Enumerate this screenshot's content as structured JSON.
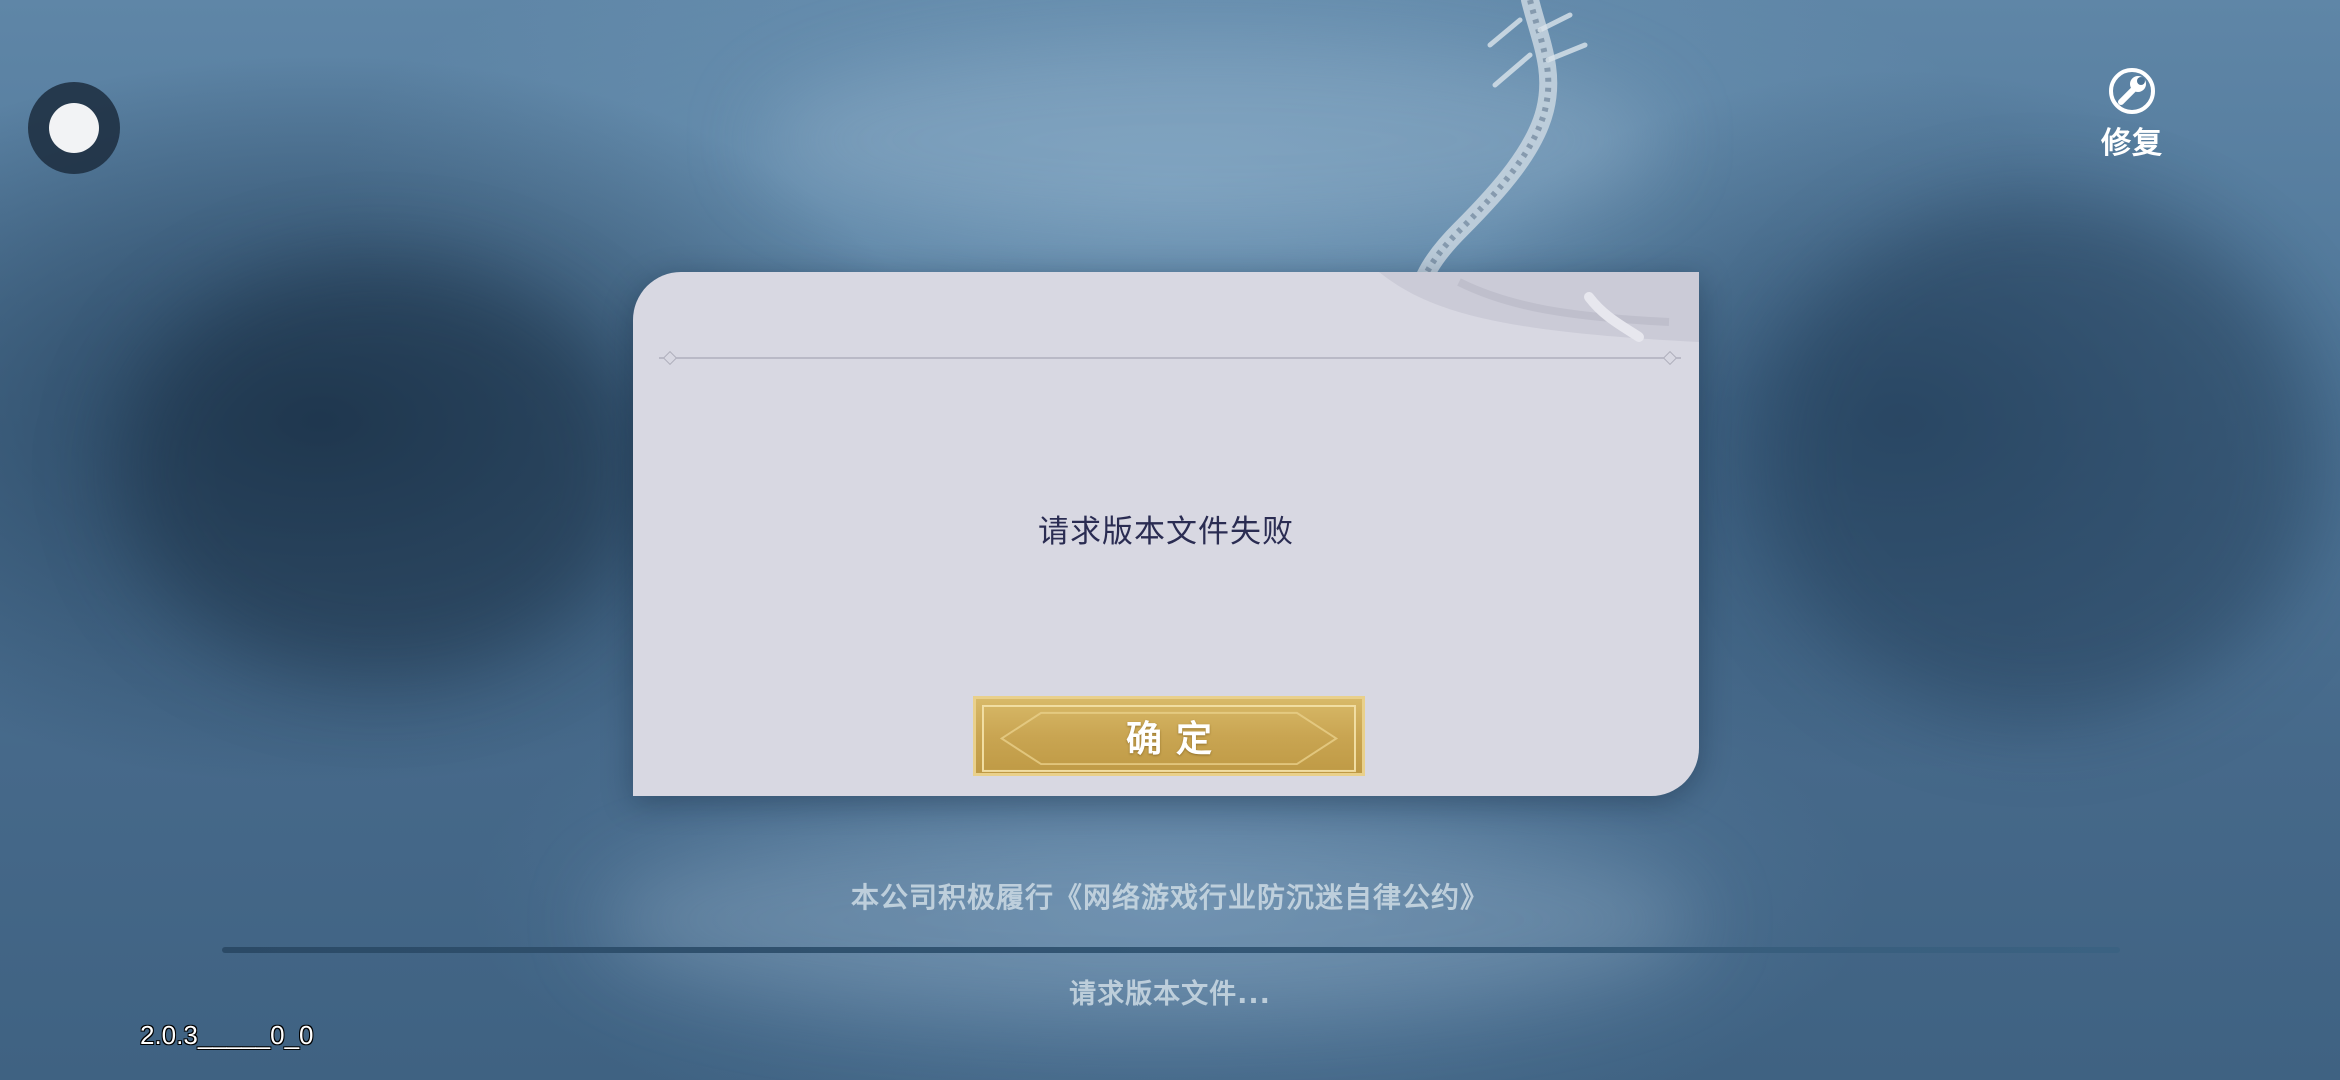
{
  "top_right": {
    "repair_label": "修复",
    "repair_icon": "wrench-icon"
  },
  "floating_button": {
    "icon": "float-ball-icon"
  },
  "dialog": {
    "message": "请求版本文件失败",
    "confirm_label": "确定"
  },
  "footer": {
    "notice": "本公司积极履行《网络游戏行业防沉迷自律公约》",
    "status": "请求版本文件...",
    "progress": 1.0,
    "version": "2.0.3_____0_0"
  },
  "colors": {
    "dialog_bg": "#d8d8e2",
    "message_text": "#2a2c52",
    "button_gold": "#c9a552"
  }
}
